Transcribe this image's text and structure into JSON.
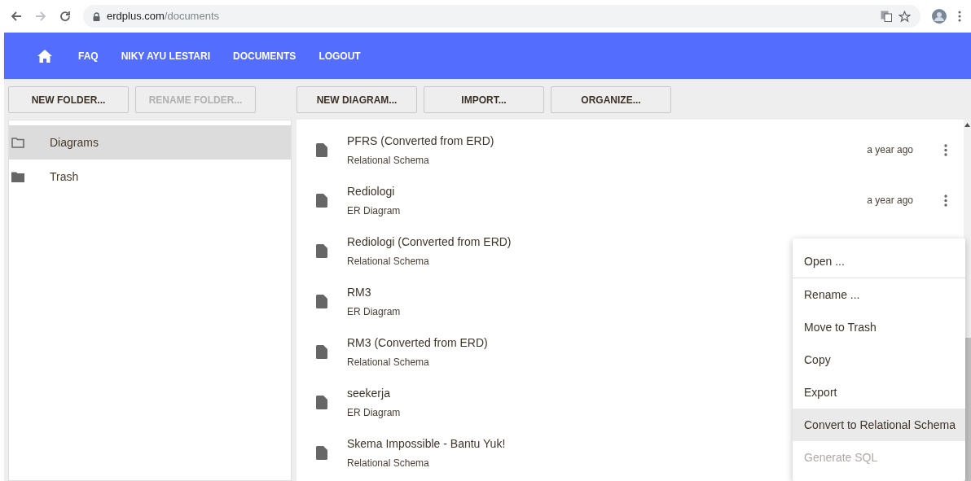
{
  "browser": {
    "url_host": "erdplus.com",
    "url_path": "/documents",
    "forward_disabled": true
  },
  "nav": {
    "links": [
      "FAQ",
      "NIKY AYU LESTARI",
      "DOCUMENTS",
      "LOGOUT"
    ]
  },
  "folder_toolbar": [
    {
      "label": "NEW FOLDER...",
      "disabled": false
    },
    {
      "label": "RENAME FOLDER...",
      "disabled": true
    }
  ],
  "document_toolbar": [
    {
      "label": "NEW DIAGRAM...",
      "disabled": false
    },
    {
      "label": "IMPORT...",
      "disabled": false
    },
    {
      "label": "ORGANIZE...",
      "disabled": false
    }
  ],
  "folders": [
    {
      "label": "Diagrams",
      "selected": true
    },
    {
      "label": "Trash",
      "selected": false
    }
  ],
  "documents": [
    {
      "title": "PFRS (Converted from ERD)",
      "type": "Relational Schema",
      "time": "a year ago"
    },
    {
      "title": "Rediologi",
      "type": "ER Diagram",
      "time": "a year ago"
    },
    {
      "title": "Rediologi (Converted from ERD)",
      "type": "Relational Schema"
    },
    {
      "title": "RM3",
      "type": "ER Diagram"
    },
    {
      "title": "RM3 (Converted from ERD)",
      "type": "Relational Schema"
    },
    {
      "title": "seekerja",
      "type": "ER Diagram"
    },
    {
      "title": "Skema Impossible - Bantu Yuk!",
      "type": "Relational Schema"
    }
  ],
  "context_menu": {
    "sections": [
      {
        "items": [
          {
            "label": "Open ...",
            "highlighted": false,
            "disabled": false
          }
        ]
      },
      {
        "items": [
          {
            "label": "Rename ...",
            "highlighted": false,
            "disabled": false
          },
          {
            "label": "Move to Trash",
            "highlighted": false,
            "disabled": false
          },
          {
            "label": "Copy",
            "highlighted": false,
            "disabled": false
          },
          {
            "label": "Export",
            "highlighted": false,
            "disabled": false
          },
          {
            "label": "Convert to Relational Schema",
            "highlighted": true,
            "disabled": false
          },
          {
            "label": "Generate SQL",
            "highlighted": false,
            "disabled": true
          }
        ]
      }
    ]
  }
}
